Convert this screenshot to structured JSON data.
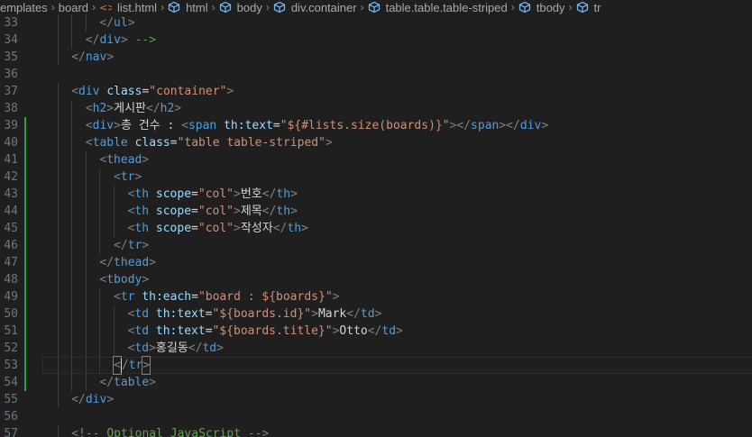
{
  "breadcrumb": [
    {
      "label": "emplates",
      "icon": ""
    },
    {
      "label": "board",
      "icon": ""
    },
    {
      "label": "list.html",
      "icon": "html-file-icon"
    },
    {
      "label": "html",
      "icon": "element-cube-icon"
    },
    {
      "label": "body",
      "icon": "element-cube-icon"
    },
    {
      "label": "div.container",
      "icon": "element-cube-icon"
    },
    {
      "label": "table.table.table-striped",
      "icon": "element-cube-icon"
    },
    {
      "label": "tbody",
      "icon": "element-cube-icon"
    },
    {
      "label": "tr",
      "icon": "element-cube-icon"
    }
  ],
  "colors": {
    "tag": "#569cd6",
    "attribute": "#9cdcfe",
    "string": "#ce9178",
    "text": "#d4d4d4",
    "punctuation": "#808080",
    "comment": "#6a9955",
    "line_number": "#6e7681",
    "gutter_modified": "#2ea043",
    "background": "#1f1f1f"
  },
  "editor": {
    "lines": [
      {
        "num": "33",
        "indent": 4,
        "tokens": [
          [
            "p",
            "</"
          ],
          [
            "t",
            "ul"
          ],
          [
            "p",
            ">"
          ]
        ]
      },
      {
        "num": "34",
        "indent": 3,
        "tokens": [
          [
            "p",
            "</"
          ],
          [
            "t",
            "div"
          ],
          [
            "p",
            ">"
          ],
          [
            "c",
            " -->"
          ]
        ]
      },
      {
        "num": "35",
        "indent": 2,
        "tokens": [
          [
            "p",
            "</"
          ],
          [
            "t",
            "nav"
          ],
          [
            "p",
            ">"
          ]
        ]
      },
      {
        "num": "36",
        "indent": 0,
        "tokens": []
      },
      {
        "num": "37",
        "indent": 2,
        "tokens": [
          [
            "p",
            "<"
          ],
          [
            "t",
            "div"
          ],
          [
            "x",
            " "
          ],
          [
            "a",
            "class"
          ],
          [
            "x",
            "="
          ],
          [
            "s",
            "\"container\""
          ],
          [
            "p",
            ">"
          ]
        ]
      },
      {
        "num": "38",
        "indent": 3,
        "tokens": [
          [
            "p",
            "<"
          ],
          [
            "t",
            "h2"
          ],
          [
            "p",
            ">"
          ],
          [
            "x",
            "게시판"
          ],
          [
            "p",
            "</"
          ],
          [
            "t",
            "h2"
          ],
          [
            "p",
            ">"
          ]
        ]
      },
      {
        "num": "39",
        "indent": 3,
        "tokens": [
          [
            "p",
            "<"
          ],
          [
            "t",
            "div"
          ],
          [
            "p",
            ">"
          ],
          [
            "x",
            "총 건수 : "
          ],
          [
            "p",
            "<"
          ],
          [
            "t",
            "span"
          ],
          [
            "x",
            " "
          ],
          [
            "a",
            "th:text"
          ],
          [
            "x",
            "="
          ],
          [
            "s",
            "\"${#lists.size(boards)}\""
          ],
          [
            "p",
            "></"
          ],
          [
            "t",
            "span"
          ],
          [
            "p",
            "></"
          ],
          [
            "t",
            "div"
          ],
          [
            "p",
            ">"
          ]
        ]
      },
      {
        "num": "40",
        "indent": 3,
        "tokens": [
          [
            "p",
            "<"
          ],
          [
            "t",
            "table"
          ],
          [
            "x",
            " "
          ],
          [
            "a",
            "class"
          ],
          [
            "x",
            "="
          ],
          [
            "s",
            "\"table table-striped\""
          ],
          [
            "p",
            ">"
          ]
        ]
      },
      {
        "num": "41",
        "indent": 4,
        "tokens": [
          [
            "p",
            "<"
          ],
          [
            "t",
            "thead"
          ],
          [
            "p",
            ">"
          ]
        ]
      },
      {
        "num": "42",
        "indent": 5,
        "tokens": [
          [
            "p",
            "<"
          ],
          [
            "t",
            "tr"
          ],
          [
            "p",
            ">"
          ]
        ]
      },
      {
        "num": "43",
        "indent": 6,
        "tokens": [
          [
            "p",
            "<"
          ],
          [
            "t",
            "th"
          ],
          [
            "x",
            " "
          ],
          [
            "a",
            "scope"
          ],
          [
            "x",
            "="
          ],
          [
            "s",
            "\"col\""
          ],
          [
            "p",
            ">"
          ],
          [
            "x",
            "번호"
          ],
          [
            "p",
            "</"
          ],
          [
            "t",
            "th"
          ],
          [
            "p",
            ">"
          ]
        ]
      },
      {
        "num": "44",
        "indent": 6,
        "tokens": [
          [
            "p",
            "<"
          ],
          [
            "t",
            "th"
          ],
          [
            "x",
            " "
          ],
          [
            "a",
            "scope"
          ],
          [
            "x",
            "="
          ],
          [
            "s",
            "\"col\""
          ],
          [
            "p",
            ">"
          ],
          [
            "x",
            "제목"
          ],
          [
            "p",
            "</"
          ],
          [
            "t",
            "th"
          ],
          [
            "p",
            ">"
          ]
        ]
      },
      {
        "num": "45",
        "indent": 6,
        "tokens": [
          [
            "p",
            "<"
          ],
          [
            "t",
            "th"
          ],
          [
            "x",
            " "
          ],
          [
            "a",
            "scope"
          ],
          [
            "x",
            "="
          ],
          [
            "s",
            "\"col\""
          ],
          [
            "p",
            ">"
          ],
          [
            "x",
            "작성자"
          ],
          [
            "p",
            "</"
          ],
          [
            "t",
            "th"
          ],
          [
            "p",
            ">"
          ]
        ]
      },
      {
        "num": "46",
        "indent": 5,
        "tokens": [
          [
            "p",
            "</"
          ],
          [
            "t",
            "tr"
          ],
          [
            "p",
            ">"
          ]
        ]
      },
      {
        "num": "47",
        "indent": 4,
        "tokens": [
          [
            "p",
            "</"
          ],
          [
            "t",
            "thead"
          ],
          [
            "p",
            ">"
          ]
        ]
      },
      {
        "num": "48",
        "indent": 4,
        "tokens": [
          [
            "p",
            "<"
          ],
          [
            "t",
            "tbody"
          ],
          [
            "p",
            ">"
          ]
        ]
      },
      {
        "num": "49",
        "indent": 5,
        "tokens": [
          [
            "p",
            "<"
          ],
          [
            "t",
            "tr"
          ],
          [
            "x",
            " "
          ],
          [
            "a",
            "th:each"
          ],
          [
            "x",
            "="
          ],
          [
            "s",
            "\"board : ${boards}\""
          ],
          [
            "p",
            ">"
          ]
        ]
      },
      {
        "num": "50",
        "indent": 6,
        "tokens": [
          [
            "p",
            "<"
          ],
          [
            "t",
            "td"
          ],
          [
            "x",
            " "
          ],
          [
            "a",
            "th:text"
          ],
          [
            "x",
            "="
          ],
          [
            "s",
            "\"${boards.id}\""
          ],
          [
            "p",
            ">"
          ],
          [
            "x",
            "Mark"
          ],
          [
            "p",
            "</"
          ],
          [
            "t",
            "td"
          ],
          [
            "p",
            ">"
          ]
        ]
      },
      {
        "num": "51",
        "indent": 6,
        "tokens": [
          [
            "p",
            "<"
          ],
          [
            "t",
            "td"
          ],
          [
            "x",
            " "
          ],
          [
            "a",
            "th:text"
          ],
          [
            "x",
            "="
          ],
          [
            "s",
            "\"${boards.title}\""
          ],
          [
            "p",
            ">"
          ],
          [
            "x",
            "Otto"
          ],
          [
            "p",
            "</"
          ],
          [
            "t",
            "td"
          ],
          [
            "p",
            ">"
          ]
        ]
      },
      {
        "num": "52",
        "indent": 6,
        "tokens": [
          [
            "p",
            "<"
          ],
          [
            "t",
            "td"
          ],
          [
            "p",
            ">"
          ],
          [
            "x",
            "홍길동"
          ],
          [
            "p",
            "</"
          ],
          [
            "t",
            "td"
          ],
          [
            "p",
            ">"
          ]
        ]
      },
      {
        "num": "53",
        "indent": 5,
        "tokens": [
          [
            "b",
            "<"
          ],
          [
            "k",
            ""
          ],
          [
            "p",
            "/"
          ],
          [
            "t",
            "tr"
          ],
          [
            "b",
            ">"
          ]
        ]
      },
      {
        "num": "54",
        "indent": 4,
        "tokens": [
          [
            "p",
            "</"
          ],
          [
            "t",
            "table"
          ],
          [
            "p",
            ">"
          ]
        ]
      },
      {
        "num": "55",
        "indent": 2,
        "tokens": [
          [
            "p",
            "</"
          ],
          [
            "t",
            "div"
          ],
          [
            "p",
            ">"
          ]
        ]
      },
      {
        "num": "56",
        "indent": 0,
        "tokens": []
      },
      {
        "num": "57",
        "indent": 2,
        "tokens": [
          [
            "p",
            "<!-- "
          ],
          [
            "c",
            "Optional JavaScript"
          ],
          [
            "p",
            " -->"
          ]
        ]
      }
    ]
  }
}
